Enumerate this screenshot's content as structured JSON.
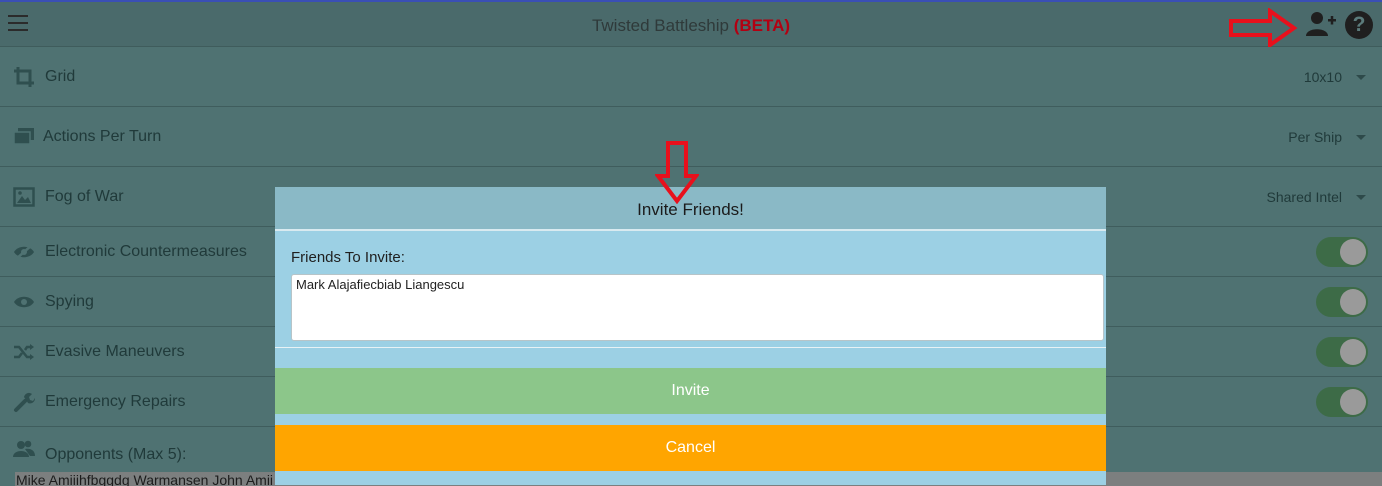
{
  "header": {
    "title": "Twisted Battleship",
    "beta": "(BETA)"
  },
  "settings": {
    "grid": {
      "label": "Grid",
      "value": "10x10"
    },
    "actions": {
      "label": "Actions Per Turn",
      "value": "Per Ship"
    },
    "fog": {
      "label": "Fog of War",
      "value": "Shared Intel"
    },
    "ecm": {
      "label": "Electronic Countermeasures",
      "on": true
    },
    "spying": {
      "label": "Spying",
      "on": true
    },
    "evasive": {
      "label": "Evasive Maneuvers",
      "on": true
    },
    "repairs": {
      "label": "Emergency Repairs",
      "on": true
    }
  },
  "opponents": {
    "label": "Opponents (Max 5):",
    "value": "Mike Amiiihfbggdg Warmansen John Amii"
  },
  "modal": {
    "title": "Invite Friends!",
    "field_label": "Friends To Invite:",
    "friends_value": "Mark Alajafiecbiab Liangescu",
    "invite_label": "Invite",
    "cancel_label": "Cancel"
  },
  "colors": {
    "annotation_arrow": "#e8101c",
    "invite_button": "#8cc68a",
    "cancel_button": "#ffa500"
  },
  "icons": [
    "menu-icon",
    "add-user-icon",
    "help-icon",
    "crop-icon",
    "layers-icon",
    "image-icon",
    "eye-slash-icon",
    "eye-icon",
    "shuffle-icon",
    "wrench-icon",
    "users-icon"
  ]
}
